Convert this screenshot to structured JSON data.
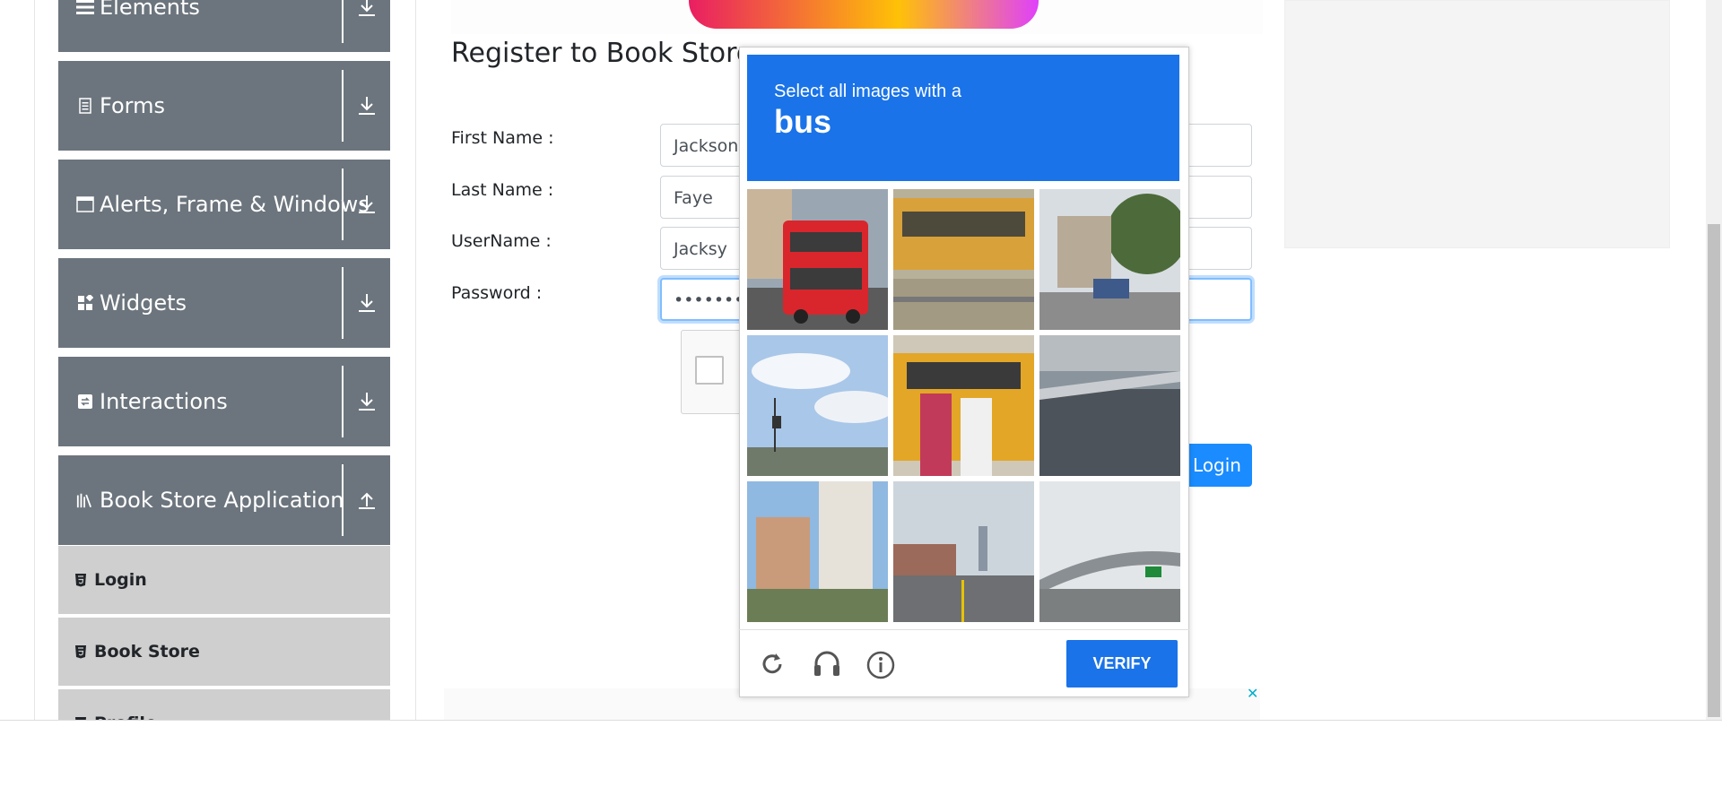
{
  "sidebar": {
    "groups": [
      {
        "label": "Elements",
        "icon": "list-icon"
      },
      {
        "label": "Forms",
        "icon": "document-icon"
      },
      {
        "label": "Alerts, Frame & Windows",
        "icon": "window-icon"
      },
      {
        "label": "Widgets",
        "icon": "widgets-icon"
      },
      {
        "label": "Interactions",
        "icon": "interactions-icon"
      },
      {
        "label": "Book Store Application",
        "icon": "books-icon"
      }
    ],
    "subitems": [
      {
        "label": "Login"
      },
      {
        "label": "Book Store"
      },
      {
        "label": "Profile"
      }
    ]
  },
  "form": {
    "title": "Register to Book Store",
    "first_name_label": "First Name :",
    "first_name_value": "Jackson",
    "last_name_label": "Last Name :",
    "last_name_value": "Faye",
    "username_label": "UserName :",
    "username_value": "Jacksy",
    "password_label": "Password :",
    "password_value": "••••••••••",
    "login_button": "Login"
  },
  "captcha": {
    "instruction": "Select all images with a",
    "target": "bus",
    "verify_label": "VERIFY",
    "accent": "#1a73e8"
  },
  "colors": {
    "sidebar_group": "#6c757d",
    "sidebar_sub": "#cfcfcf",
    "primary": "#1a8cff"
  }
}
